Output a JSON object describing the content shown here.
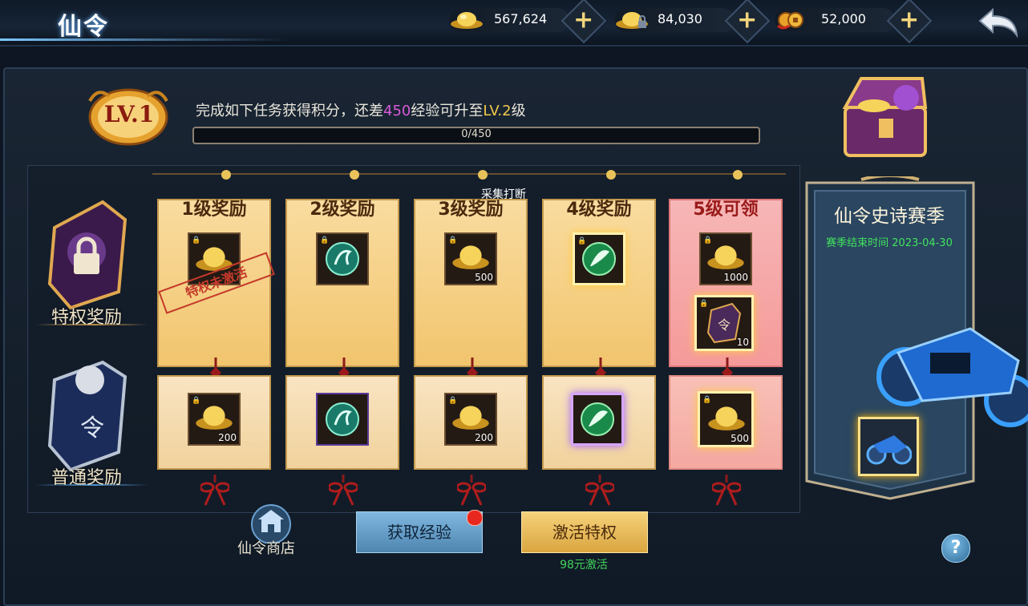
{
  "header": {
    "title": "仙令",
    "currencies": [
      {
        "icon": "gold-ingot-icon",
        "value": "567,624"
      },
      {
        "icon": "locked-gold-ingot-icon",
        "value": "84,030"
      },
      {
        "icon": "coin-string-icon",
        "value": "52,000"
      }
    ],
    "plus_label": "+"
  },
  "level": {
    "badge": "LV.1",
    "task_prefix": "完成如下任务获得积分，还差",
    "exp_needed": "450",
    "task_middle": "经验可升至",
    "next_level": "LV.2",
    "task_suffix": "级",
    "progress_text": "0/450",
    "progress_fraction": 0.0
  },
  "rows": {
    "premium_label": "特权奖励",
    "normal_label": "普通奖励"
  },
  "columns": [
    {
      "title": "1级奖励",
      "premium": {
        "icon": "gold-ingot-icon",
        "qty": "",
        "stamp": "特权未激活"
      },
      "normal": {
        "icon": "gold-ingot-icon",
        "qty": "200"
      }
    },
    {
      "title": "2级奖励",
      "premium": {
        "icon": "jade-horse-orb-icon",
        "qty": ""
      },
      "normal": {
        "icon": "jade-horse-orb-icon",
        "qty": ""
      }
    },
    {
      "title": "3级奖励",
      "premium": {
        "icon": "gold-ingot-icon",
        "qty": "500"
      },
      "normal": {
        "icon": "gold-ingot-icon",
        "qty": "200"
      }
    },
    {
      "title": "4级奖励",
      "premium": {
        "icon": "jade-feather-orb-icon",
        "qty": ""
      },
      "normal": {
        "icon": "jade-feather-orb-icon",
        "qty": ""
      }
    },
    {
      "title": "5级可领",
      "premium": {
        "icon": "gold-ingot-icon",
        "qty": "1000"
      },
      "premium2": {
        "icon": "xianling-token-icon",
        "qty": "10"
      },
      "normal": {
        "icon": "gold-ingot-icon",
        "qty": "500"
      }
    }
  ],
  "tooltip": "采集打断",
  "season": {
    "title": "仙令史诗赛季",
    "end_text": "赛季结束时间 2023-04-30"
  },
  "bottom": {
    "shop_label": "仙令商店",
    "get_exp_label": "获取经验",
    "activate_label": "激活特权",
    "activate_price": "98元激活",
    "help_label": "?"
  },
  "colors": {
    "accent_gold": "#f2c84a",
    "exp_purple": "#d65ad8",
    "season_green": "#41e35d",
    "notify_red": "#e8281e"
  }
}
